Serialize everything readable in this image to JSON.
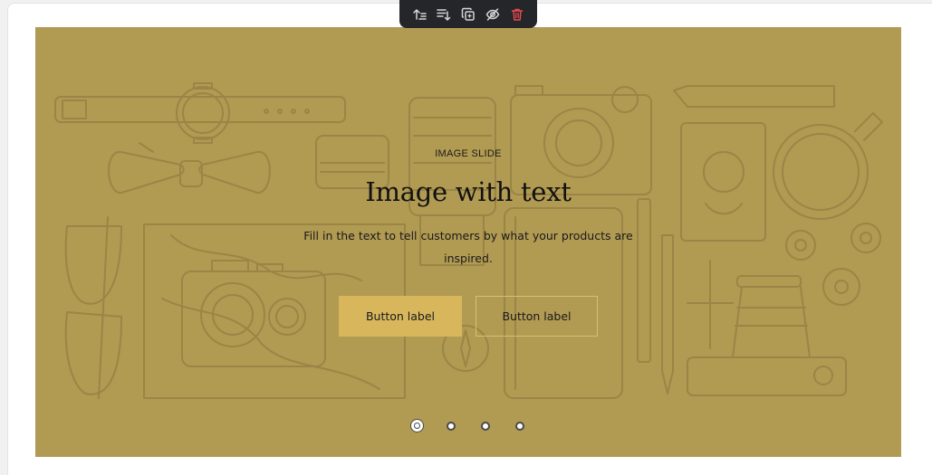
{
  "toolbar": {
    "items": [
      {
        "name": "move-up-icon"
      },
      {
        "name": "move-down-icon"
      },
      {
        "name": "duplicate-icon"
      },
      {
        "name": "hide-icon"
      },
      {
        "name": "delete-icon"
      }
    ],
    "icon_color": "#d5d5d5",
    "delete_color": "#e5484d"
  },
  "slide": {
    "eyebrow": "IMAGE SLIDE",
    "heading": "Image with text",
    "body": "Fill in the text to tell customers by what your products are inspired.",
    "primary_button": "Button label",
    "secondary_button": "Button label",
    "background_color": "#b19a52",
    "button_color": "#d8b75c"
  },
  "pagination": {
    "count": 4,
    "active_index": 0
  }
}
